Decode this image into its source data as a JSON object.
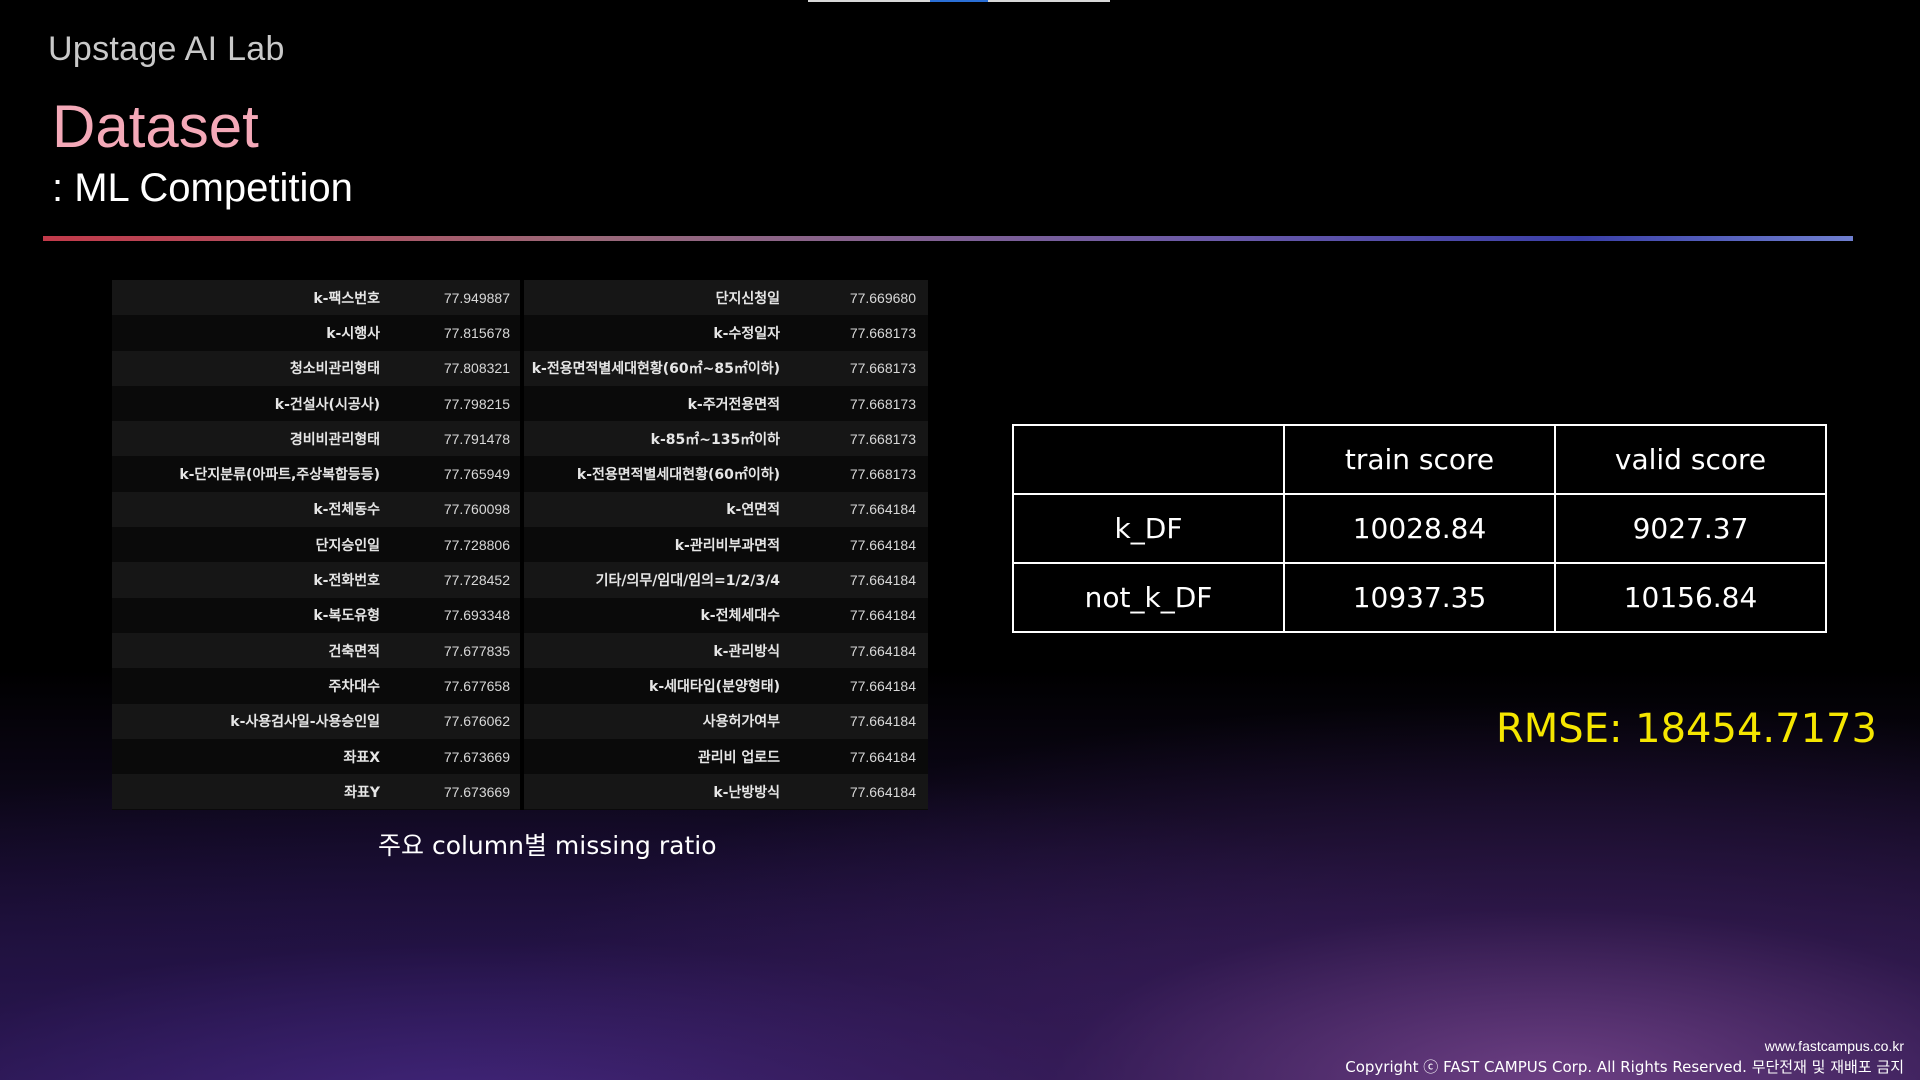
{
  "header": {
    "brand": "Upstage AI Lab",
    "title": "Dataset",
    "subtitle": ": ML Competition"
  },
  "missing_ratio": {
    "caption": "주요 column별 missing ratio",
    "rows": [
      {
        "name1": "k-팩스번호",
        "val1": "77.949887",
        "name2": "단지신청일",
        "val2": "77.669680"
      },
      {
        "name1": "k-시행사",
        "val1": "77.815678",
        "name2": "k-수정일자",
        "val2": "77.668173"
      },
      {
        "name1": "청소비관리형태",
        "val1": "77.808321",
        "name2": "k-전용면적별세대현황(60㎡~85㎡이하)",
        "val2": "77.668173"
      },
      {
        "name1": "k-건설사(시공사)",
        "val1": "77.798215",
        "name2": "k-주거전용면적",
        "val2": "77.668173"
      },
      {
        "name1": "경비비관리형태",
        "val1": "77.791478",
        "name2": "k-85㎡~135㎡이하",
        "val2": "77.668173"
      },
      {
        "name1": "k-단지분류(아파트,주상복합등등)",
        "val1": "77.765949",
        "name2": "k-전용면적별세대현황(60㎡이하)",
        "val2": "77.668173"
      },
      {
        "name1": "k-전체동수",
        "val1": "77.760098",
        "name2": "k-연면적",
        "val2": "77.664184"
      },
      {
        "name1": "단지승인일",
        "val1": "77.728806",
        "name2": "k-관리비부과면적",
        "val2": "77.664184"
      },
      {
        "name1": "k-전화번호",
        "val1": "77.728452",
        "name2": "기타/의무/임대/임의=1/2/3/4",
        "val2": "77.664184"
      },
      {
        "name1": "k-복도유형",
        "val1": "77.693348",
        "name2": "k-전체세대수",
        "val2": "77.664184"
      },
      {
        "name1": "건축면적",
        "val1": "77.677835",
        "name2": "k-관리방식",
        "val2": "77.664184"
      },
      {
        "name1": "주차대수",
        "val1": "77.677658",
        "name2": "k-세대타입(분양형태)",
        "val2": "77.664184"
      },
      {
        "name1": "k-사용검사일-사용승인일",
        "val1": "77.676062",
        "name2": "사용허가여부",
        "val2": "77.664184"
      },
      {
        "name1": "좌표X",
        "val1": "77.673669",
        "name2": "관리비 업로드",
        "val2": "77.664184"
      },
      {
        "name1": "좌표Y",
        "val1": "77.673669",
        "name2": "k-난방방식",
        "val2": "77.664184"
      }
    ]
  },
  "scores": {
    "headers": [
      "",
      "train score",
      "valid score"
    ],
    "rows": [
      {
        "label": "k_DF",
        "train": "10028.84",
        "valid": "9027.37"
      },
      {
        "label": "not_k_DF",
        "train": "10937.35",
        "valid": "10156.84"
      }
    ]
  },
  "rmse": "RMSE: 18454.7173",
  "footer": {
    "url": "www.fastcampus.co.kr",
    "copyright": "Copyright ⓒ FAST CAMPUS Corp. All Rights Reserved. 무단전재 및 재배포 금지"
  },
  "colors": {
    "title": "#f4a9b8",
    "rmse": "#f5e600",
    "divider_start": "#c23a4a",
    "divider_end": "#6f7fcf"
  }
}
